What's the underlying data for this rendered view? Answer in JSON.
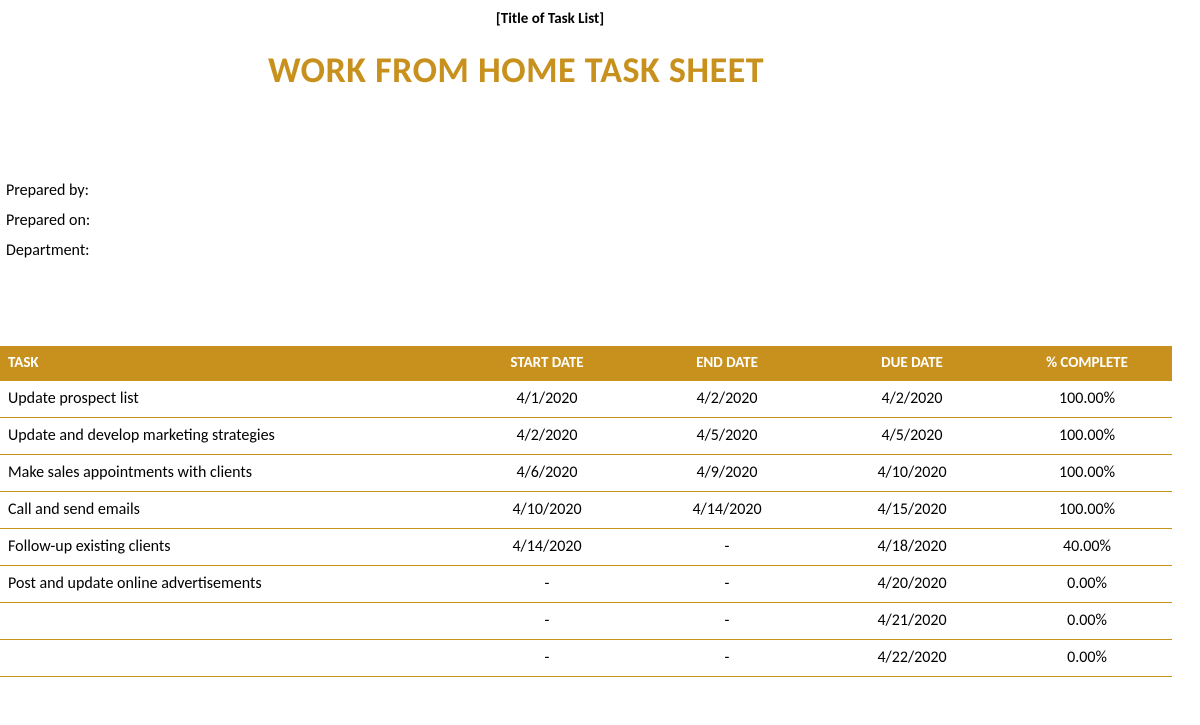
{
  "title_placeholder": "[Title of Task List]",
  "main_title": "WORK FROM HOME TASK SHEET",
  "meta": {
    "prepared_by_label": "Prepared by:",
    "prepared_on_label": "Prepared on:",
    "department_label": "Department:"
  },
  "columns": {
    "task": "TASK",
    "start_date": "START DATE",
    "end_date": "END DATE",
    "due_date": "DUE DATE",
    "pct_complete": "% COMPLETE"
  },
  "rows": [
    {
      "task": "Update prospect list",
      "start": "4/1/2020",
      "end": "4/2/2020",
      "due": "4/2/2020",
      "pct": "100.00%"
    },
    {
      "task": "Update and develop marketing strategies",
      "start": "4/2/2020",
      "end": "4/5/2020",
      "due": "4/5/2020",
      "pct": "100.00%"
    },
    {
      "task": "Make sales appointments with clients",
      "start": "4/6/2020",
      "end": "4/9/2020",
      "due": "4/10/2020",
      "pct": "100.00%"
    },
    {
      "task": "Call and send emails",
      "start": "4/10/2020",
      "end": "4/14/2020",
      "due": "4/15/2020",
      "pct": "100.00%"
    },
    {
      "task": "Follow-up existing clients",
      "start": "4/14/2020",
      "end": "-",
      "due": "4/18/2020",
      "pct": "40.00%"
    },
    {
      "task": "Post and update online advertisements",
      "start": "-",
      "end": "-",
      "due": "4/20/2020",
      "pct": "0.00%"
    },
    {
      "task": "",
      "start": "-",
      "end": "-",
      "due": "4/21/2020",
      "pct": "0.00%"
    },
    {
      "task": "",
      "start": "-",
      "end": "-",
      "due": "4/22/2020",
      "pct": "0.00%"
    }
  ]
}
